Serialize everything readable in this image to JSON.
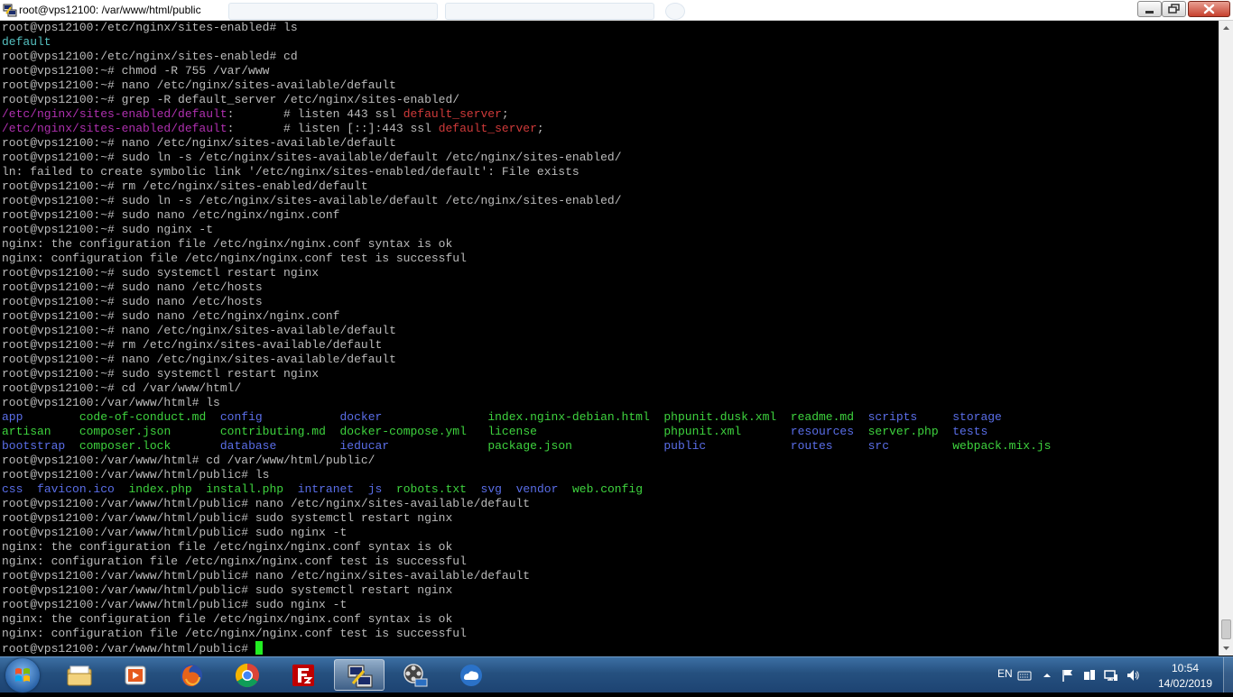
{
  "window": {
    "title": "root@vps12100: /var/www/html/public"
  },
  "colors": {
    "prompt": "#bbbbbb",
    "directory_blue": "#5a6ee8",
    "file_green": "#3ed33e",
    "grep_path_magenta": "#b030b0",
    "grep_match_red": "#d03a3a",
    "cyan": "#55c0c0",
    "cursor": "#22ee22"
  },
  "terminal": {
    "lines": [
      [
        {
          "t": "root@vps12100:/etc/nginx/sites-enabled# ls",
          "c": "white"
        }
      ],
      [
        {
          "t": "default",
          "c": "cyan"
        }
      ],
      [
        {
          "t": "root@vps12100:/etc/nginx/sites-enabled# cd",
          "c": "white"
        }
      ],
      [
        {
          "t": "root@vps12100:~# chmod -R 755 /var/www",
          "c": "white"
        }
      ],
      [
        {
          "t": "root@vps12100:~# nano /etc/nginx/sites-available/default",
          "c": "white"
        }
      ],
      [
        {
          "t": "root@vps12100:~# grep -R default_server /etc/nginx/sites-enabled/",
          "c": "white"
        }
      ],
      [
        {
          "t": "/etc/nginx/sites-enabled/default",
          "c": "magenta"
        },
        {
          "t": ":       # listen 443 ssl ",
          "c": "white"
        },
        {
          "t": "default_server",
          "c": "red"
        },
        {
          "t": ";",
          "c": "white"
        }
      ],
      [
        {
          "t": "/etc/nginx/sites-enabled/default",
          "c": "magenta"
        },
        {
          "t": ":       # listen [::]:443 ssl ",
          "c": "white"
        },
        {
          "t": "default_server",
          "c": "red"
        },
        {
          "t": ";",
          "c": "white"
        }
      ],
      [
        {
          "t": "root@vps12100:~# nano /etc/nginx/sites-available/default",
          "c": "white"
        }
      ],
      [
        {
          "t": "root@vps12100:~# sudo ln -s /etc/nginx/sites-available/default /etc/nginx/sites-enabled/",
          "c": "white"
        }
      ],
      [
        {
          "t": "ln: failed to create symbolic link '/etc/nginx/sites-enabled/default': File exists",
          "c": "white"
        }
      ],
      [
        {
          "t": "root@vps12100:~# rm /etc/nginx/sites-enabled/default",
          "c": "white"
        }
      ],
      [
        {
          "t": "root@vps12100:~# sudo ln -s /etc/nginx/sites-available/default /etc/nginx/sites-enabled/",
          "c": "white"
        }
      ],
      [
        {
          "t": "root@vps12100:~# sudo nano /etc/nginx/nginx.conf",
          "c": "white"
        }
      ],
      [
        {
          "t": "root@vps12100:~# sudo nginx -t",
          "c": "white"
        }
      ],
      [
        {
          "t": "nginx: the configuration file /etc/nginx/nginx.conf syntax is ok",
          "c": "white"
        }
      ],
      [
        {
          "t": "nginx: configuration file /etc/nginx/nginx.conf test is successful",
          "c": "white"
        }
      ],
      [
        {
          "t": "root@vps12100:~# sudo systemctl restart nginx",
          "c": "white"
        }
      ],
      [
        {
          "t": "root@vps12100:~# sudo nano /etc/hosts",
          "c": "white"
        }
      ],
      [
        {
          "t": "root@vps12100:~# sudo nano /etc/hosts",
          "c": "white"
        }
      ],
      [
        {
          "t": "root@vps12100:~# sudo nano /etc/nginx/nginx.conf",
          "c": "white"
        }
      ],
      [
        {
          "t": "root@vps12100:~# nano /etc/nginx/sites-available/default",
          "c": "white"
        }
      ],
      [
        {
          "t": "root@vps12100:~# rm /etc/nginx/sites-available/default",
          "c": "white"
        }
      ],
      [
        {
          "t": "root@vps12100:~# nano /etc/nginx/sites-available/default",
          "c": "white"
        }
      ],
      [
        {
          "t": "root@vps12100:~# sudo systemctl restart nginx",
          "c": "white"
        }
      ],
      [
        {
          "t": "root@vps12100:~# cd /var/www/html/",
          "c": "white"
        }
      ],
      [
        {
          "t": "root@vps12100:/var/www/html# ls",
          "c": "white"
        }
      ],
      [
        {
          "t": "app        ",
          "c": "blue"
        },
        {
          "t": "code-of-conduct.md  ",
          "c": "green"
        },
        {
          "t": "config           ",
          "c": "blue"
        },
        {
          "t": "docker               ",
          "c": "blue"
        },
        {
          "t": "index.nginx-debian.html  ",
          "c": "green"
        },
        {
          "t": "phpunit.dusk.xml  ",
          "c": "green"
        },
        {
          "t": "readme.md  ",
          "c": "green"
        },
        {
          "t": "scripts     ",
          "c": "blue"
        },
        {
          "t": "storage",
          "c": "blue"
        }
      ],
      [
        {
          "t": "artisan    ",
          "c": "green"
        },
        {
          "t": "composer.json       ",
          "c": "green"
        },
        {
          "t": "contributing.md  ",
          "c": "green"
        },
        {
          "t": "docker-compose.yml   ",
          "c": "green"
        },
        {
          "t": "license                  ",
          "c": "green"
        },
        {
          "t": "phpunit.xml       ",
          "c": "green"
        },
        {
          "t": "resources  ",
          "c": "blue"
        },
        {
          "t": "server.php  ",
          "c": "green"
        },
        {
          "t": "tests",
          "c": "blue"
        }
      ],
      [
        {
          "t": "bootstrap  ",
          "c": "blue"
        },
        {
          "t": "composer.lock       ",
          "c": "green"
        },
        {
          "t": "database         ",
          "c": "blue"
        },
        {
          "t": "ieducar              ",
          "c": "blue"
        },
        {
          "t": "package.json             ",
          "c": "green"
        },
        {
          "t": "public            ",
          "c": "blue"
        },
        {
          "t": "routes     ",
          "c": "blue"
        },
        {
          "t": "src         ",
          "c": "blue"
        },
        {
          "t": "webpack.mix.js",
          "c": "green"
        }
      ],
      [
        {
          "t": "root@vps12100:/var/www/html# cd /var/www/html/public/",
          "c": "white"
        }
      ],
      [
        {
          "t": "root@vps12100:/var/www/html/public# ls",
          "c": "white"
        }
      ],
      [
        {
          "t": "css  ",
          "c": "blue"
        },
        {
          "t": "favicon.ico  ",
          "c": "blue"
        },
        {
          "t": "index.php  ",
          "c": "green"
        },
        {
          "t": "install.php  ",
          "c": "green"
        },
        {
          "t": "intranet  ",
          "c": "blue"
        },
        {
          "t": "js  ",
          "c": "blue"
        },
        {
          "t": "robots.txt  ",
          "c": "green"
        },
        {
          "t": "svg  ",
          "c": "blue"
        },
        {
          "t": "vendor  ",
          "c": "blue"
        },
        {
          "t": "web.config",
          "c": "green"
        }
      ],
      [
        {
          "t": "root@vps12100:/var/www/html/public# nano /etc/nginx/sites-available/default",
          "c": "white"
        }
      ],
      [
        {
          "t": "root@vps12100:/var/www/html/public# sudo systemctl restart nginx",
          "c": "white"
        }
      ],
      [
        {
          "t": "root@vps12100:/var/www/html/public# sudo nginx -t",
          "c": "white"
        }
      ],
      [
        {
          "t": "nginx: the configuration file /etc/nginx/nginx.conf syntax is ok",
          "c": "white"
        }
      ],
      [
        {
          "t": "nginx: configuration file /etc/nginx/nginx.conf test is successful",
          "c": "white"
        }
      ],
      [
        {
          "t": "root@vps12100:/var/www/html/public# nano /etc/nginx/sites-available/default",
          "c": "white"
        }
      ],
      [
        {
          "t": "root@vps12100:/var/www/html/public# sudo systemctl restart nginx",
          "c": "white"
        }
      ],
      [
        {
          "t": "root@vps12100:/var/www/html/public# sudo nginx -t",
          "c": "white"
        }
      ],
      [
        {
          "t": "nginx: the configuration file /etc/nginx/nginx.conf syntax is ok",
          "c": "white"
        }
      ],
      [
        {
          "t": "nginx: configuration file /etc/nginx/nginx.conf test is successful",
          "c": "white"
        }
      ],
      [
        {
          "t": "root@vps12100:/var/www/html/public# ",
          "c": "white"
        }
      ]
    ]
  },
  "taskbar": {
    "items": [
      {
        "name": "file-explorer-icon"
      },
      {
        "name": "media-player-icon"
      },
      {
        "name": "firefox-icon"
      },
      {
        "name": "chrome-icon"
      },
      {
        "name": "filezilla-icon"
      },
      {
        "name": "putty-icon",
        "active": true
      },
      {
        "name": "film-reel-icon"
      },
      {
        "name": "cloud-network-icon"
      }
    ],
    "tray": {
      "language": "EN",
      "time": "10:54",
      "date": "14/02/2019"
    }
  }
}
